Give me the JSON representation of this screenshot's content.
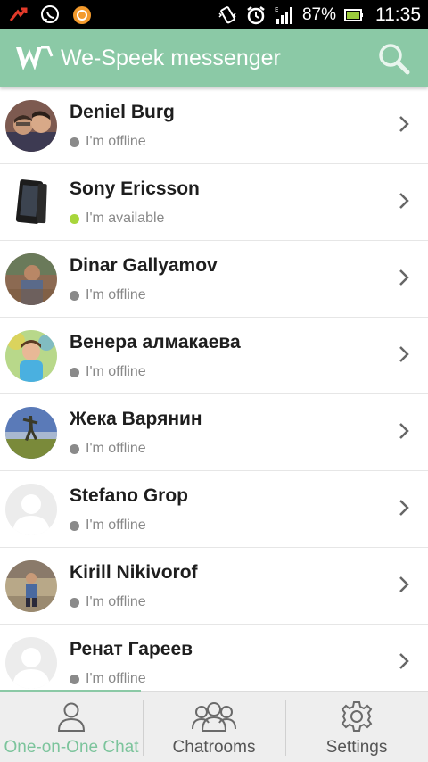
{
  "status_bar": {
    "battery_text": "87%",
    "time": "11:35",
    "icons": [
      "notification-arrow-icon",
      "viber-icon",
      "app-circle-icon",
      "vibrate-icon",
      "alarm-icon",
      "signal-icon",
      "battery-icon"
    ]
  },
  "app_bar": {
    "title": "We-Speek messenger",
    "logo_icon": "we-speek-logo",
    "search_icon": "search-icon",
    "color": "#8bc9a6"
  },
  "contacts": [
    {
      "name": "Deniel Burg",
      "status": "I'm offline",
      "state": "offline"
    },
    {
      "name": "Sony Ericsson",
      "status": "I'm available",
      "state": "available"
    },
    {
      "name": "Dinar Gallyamov",
      "status": "I'm offline",
      "state": "offline"
    },
    {
      "name": "Венера алмакаева",
      "status": "I'm offline",
      "state": "offline"
    },
    {
      "name": "Жека Варянин",
      "status": "I'm offline",
      "state": "offline"
    },
    {
      "name": "Stefano Grop",
      "status": "I'm offline",
      "state": "offline"
    },
    {
      "name": "Kirill Nikivorof",
      "status": "I'm offline",
      "state": "offline"
    },
    {
      "name": "Ренат Гареев",
      "status": "I'm offline",
      "state": "offline"
    }
  ],
  "status_colors": {
    "offline": "#8a8a8a",
    "available": "#a8d63b"
  },
  "tabs": [
    {
      "label": "One-on-One Chat",
      "icon": "person-icon",
      "active": true
    },
    {
      "label": "Chatrooms",
      "icon": "group-icon",
      "active": false
    },
    {
      "label": "Settings",
      "icon": "gear-icon",
      "active": false
    }
  ]
}
